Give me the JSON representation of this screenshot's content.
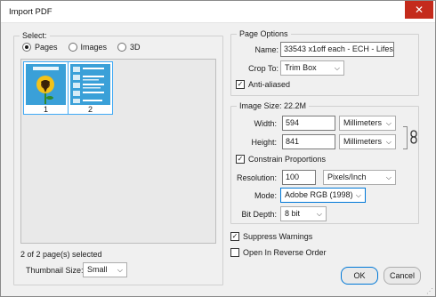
{
  "window": {
    "title": "Import PDF",
    "close_glyph": "✕"
  },
  "select_group": {
    "legend": "Select:",
    "radios": [
      {
        "label": "Pages",
        "checked": true
      },
      {
        "label": "Images",
        "checked": false
      },
      {
        "label": "3D",
        "checked": false
      }
    ],
    "thumbnails": [
      {
        "number": "1"
      },
      {
        "number": "2"
      }
    ],
    "selection_status": "2 of 2 page(s) selected",
    "thumbnail_size_label": "Thumbnail Size:",
    "thumbnail_size_value": "Small"
  },
  "page_options": {
    "legend": "Page Options",
    "name_label": "Name:",
    "name_value": "33543 x1off each - ECH - Lifest",
    "crop_label": "Crop To:",
    "crop_value": "Trim Box",
    "anti_aliased_label": "Anti-aliased",
    "anti_aliased_checked": true
  },
  "image_size": {
    "legend": "Image Size: 22.2M",
    "width_label": "Width:",
    "width_value": "594",
    "width_unit": "Millimeters",
    "height_label": "Height:",
    "height_value": "841",
    "height_unit": "Millimeters",
    "constrain_label": "Constrain Proportions",
    "constrain_checked": true,
    "resolution_label": "Resolution:",
    "resolution_value": "100",
    "resolution_unit": "Pixels/Inch",
    "mode_label": "Mode:",
    "mode_value": "Adobe RGB (1998)",
    "bitdepth_label": "Bit Depth:",
    "bitdepth_value": "8 bit"
  },
  "options": {
    "suppress_label": "Suppress Warnings",
    "suppress_checked": true,
    "reverse_label": "Open In Reverse Order",
    "reverse_checked": false
  },
  "buttons": {
    "ok": "OK",
    "cancel": "Cancel"
  },
  "colors": {
    "accent": "#0078d7",
    "close": "#c42b1c",
    "thumb_border": "#3fa9f5",
    "thumb_bg": "#3aa0d8",
    "sunflower": "#f2c21a"
  }
}
